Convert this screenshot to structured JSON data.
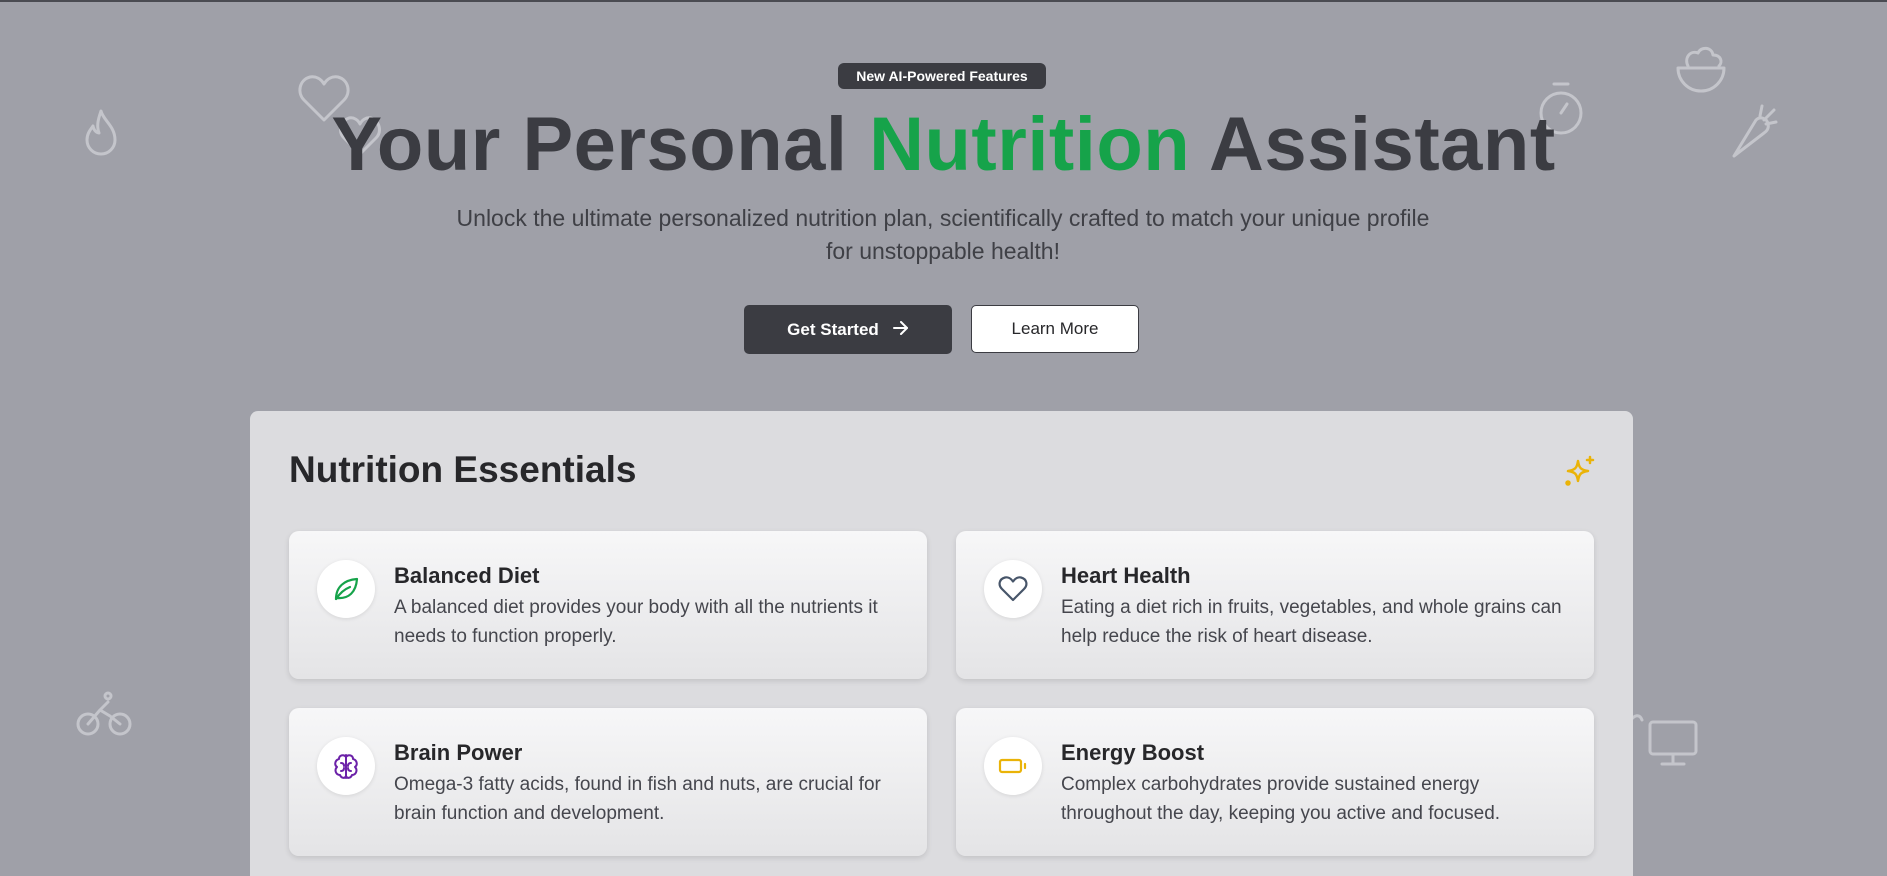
{
  "hero": {
    "badge": "New AI-Powered Features",
    "title_part1": "Your Personal ",
    "title_accent": "Nutrition",
    "title_part2": " Assistant",
    "subtitle": "Unlock the ultimate personalized nutrition plan, scientifically crafted to match your unique profile for unstoppable health!",
    "primary_button": "Get Started",
    "secondary_button": "Learn More"
  },
  "essentials": {
    "title": "Nutrition Essentials",
    "cards": [
      {
        "title": "Balanced Diet",
        "text": "A balanced diet provides your body with all the nutrients it needs to function properly.",
        "icon": "leaf-icon",
        "color": "#16a34a"
      },
      {
        "title": "Heart Health",
        "text": "Eating a diet rich in fruits, vegetables, and whole grains can help reduce the risk of heart disease.",
        "icon": "heart-icon",
        "color": "#475569"
      },
      {
        "title": "Brain Power",
        "text": "Omega-3 fatty acids, found in fish and nuts, are crucial for brain function and development.",
        "icon": "brain-icon",
        "color": "#6b21a8"
      },
      {
        "title": "Energy Boost",
        "text": "Complex carbohydrates provide sustained energy throughout the day, keeping you active and focused.",
        "icon": "battery-icon",
        "color": "#eab308"
      }
    ]
  },
  "colors": {
    "accent": "#16a34a",
    "dark": "#3b3c42",
    "background": "#9fa0a8",
    "panel": "#dcdcdf",
    "sparkle": "#eab308"
  }
}
